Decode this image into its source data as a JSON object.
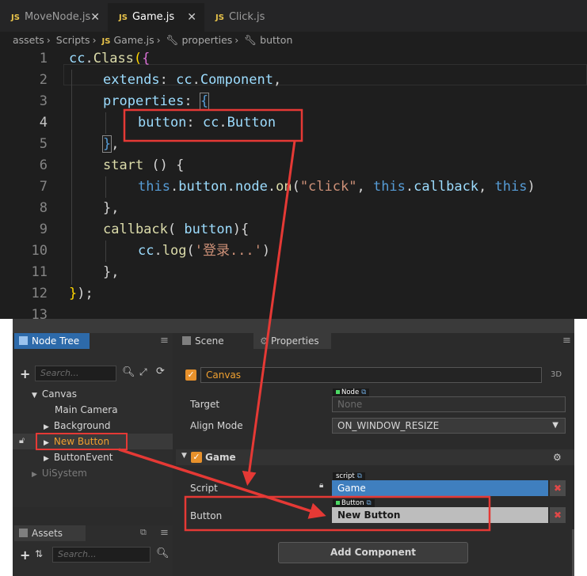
{
  "tabs": [
    {
      "label": "MoveNode.js",
      "close": "✕"
    },
    {
      "label": "Game.js",
      "close": "✕"
    },
    {
      "label": "Click.js"
    }
  ],
  "js_badge": "JS",
  "breadcrumb": [
    "assets",
    "Scripts",
    "Game.js",
    "properties",
    "button"
  ],
  "code_lines": [
    {
      "n": "1"
    },
    {
      "n": "2"
    },
    {
      "n": "3"
    },
    {
      "n": "4"
    },
    {
      "n": "5"
    },
    {
      "n": "6"
    },
    {
      "n": "7"
    },
    {
      "n": "8"
    },
    {
      "n": "9"
    },
    {
      "n": "10"
    },
    {
      "n": "11"
    },
    {
      "n": "12"
    },
    {
      "n": "13"
    }
  ],
  "code": {
    "l1a": "cc",
    "l1b": ".",
    "l1c": "Class",
    "l1d": "(",
    "l1e": "{",
    "l2a": "extends",
    "l2b": ": ",
    "l2c": "cc",
    "l2d": ".",
    "l2e": "Component",
    "l2f": ",",
    "l3a": "properties",
    "l3b": ": ",
    "l3c": "{",
    "l4a": "button",
    "l4b": ": ",
    "l4c": "cc",
    "l4d": ".",
    "l4e": "Button",
    "l5a": "}",
    "l5b": ",",
    "l6a": "start",
    "l6b": " () {",
    "l7a": "this",
    "l7b": ".",
    "l7c": "button",
    "l7d": ".",
    "l7e": "node",
    "l7f": ".",
    "l7g": "on",
    "l7h": "(",
    "l7i": "\"click\"",
    "l7j": ", ",
    "l7k": "this",
    "l7l": ".",
    "l7m": "callback",
    "l7n": ", ",
    "l7o": "this",
    "l7p": ")",
    "l8a": "},",
    "l9a": "callback",
    "l9b": "( ",
    "l9c": "button",
    "l9d": "){",
    "l10a": "cc",
    "l10b": ".",
    "l10c": "log",
    "l10d": "(",
    "l10e": "'登录...'",
    "l10f": ")",
    "l11a": "},",
    "l12a": "}",
    "l12b": ");"
  },
  "node_tree": {
    "tab_label": "Node Tree",
    "search_placeholder": "Search...",
    "items": [
      "Canvas",
      "Main Camera",
      "Background",
      "New Button",
      "ButtonEvent",
      "UiSystem"
    ]
  },
  "assets": {
    "tab_label": "Assets",
    "search_placeholder": "Search..."
  },
  "scene_tab": "Scene",
  "properties_tab": "Properties",
  "inspector": {
    "node_name": "Canvas",
    "mode_3d": "3D",
    "node_chip": "Node",
    "target_label": "Target",
    "target_value": "None",
    "align_mode_label": "Align Mode",
    "align_mode_value": "ON_WINDOW_RESIZE",
    "component_name": "Game",
    "script_chip": "script",
    "script_label": "Script",
    "script_value": "Game",
    "button_chip": "Button",
    "button_label": "Button",
    "button_value": "New Button",
    "add_component": "Add Component"
  },
  "colors": {
    "accent_orange": "#e8912b",
    "highlight_red": "#e53935",
    "selected_blue": "#2d6aaa"
  }
}
